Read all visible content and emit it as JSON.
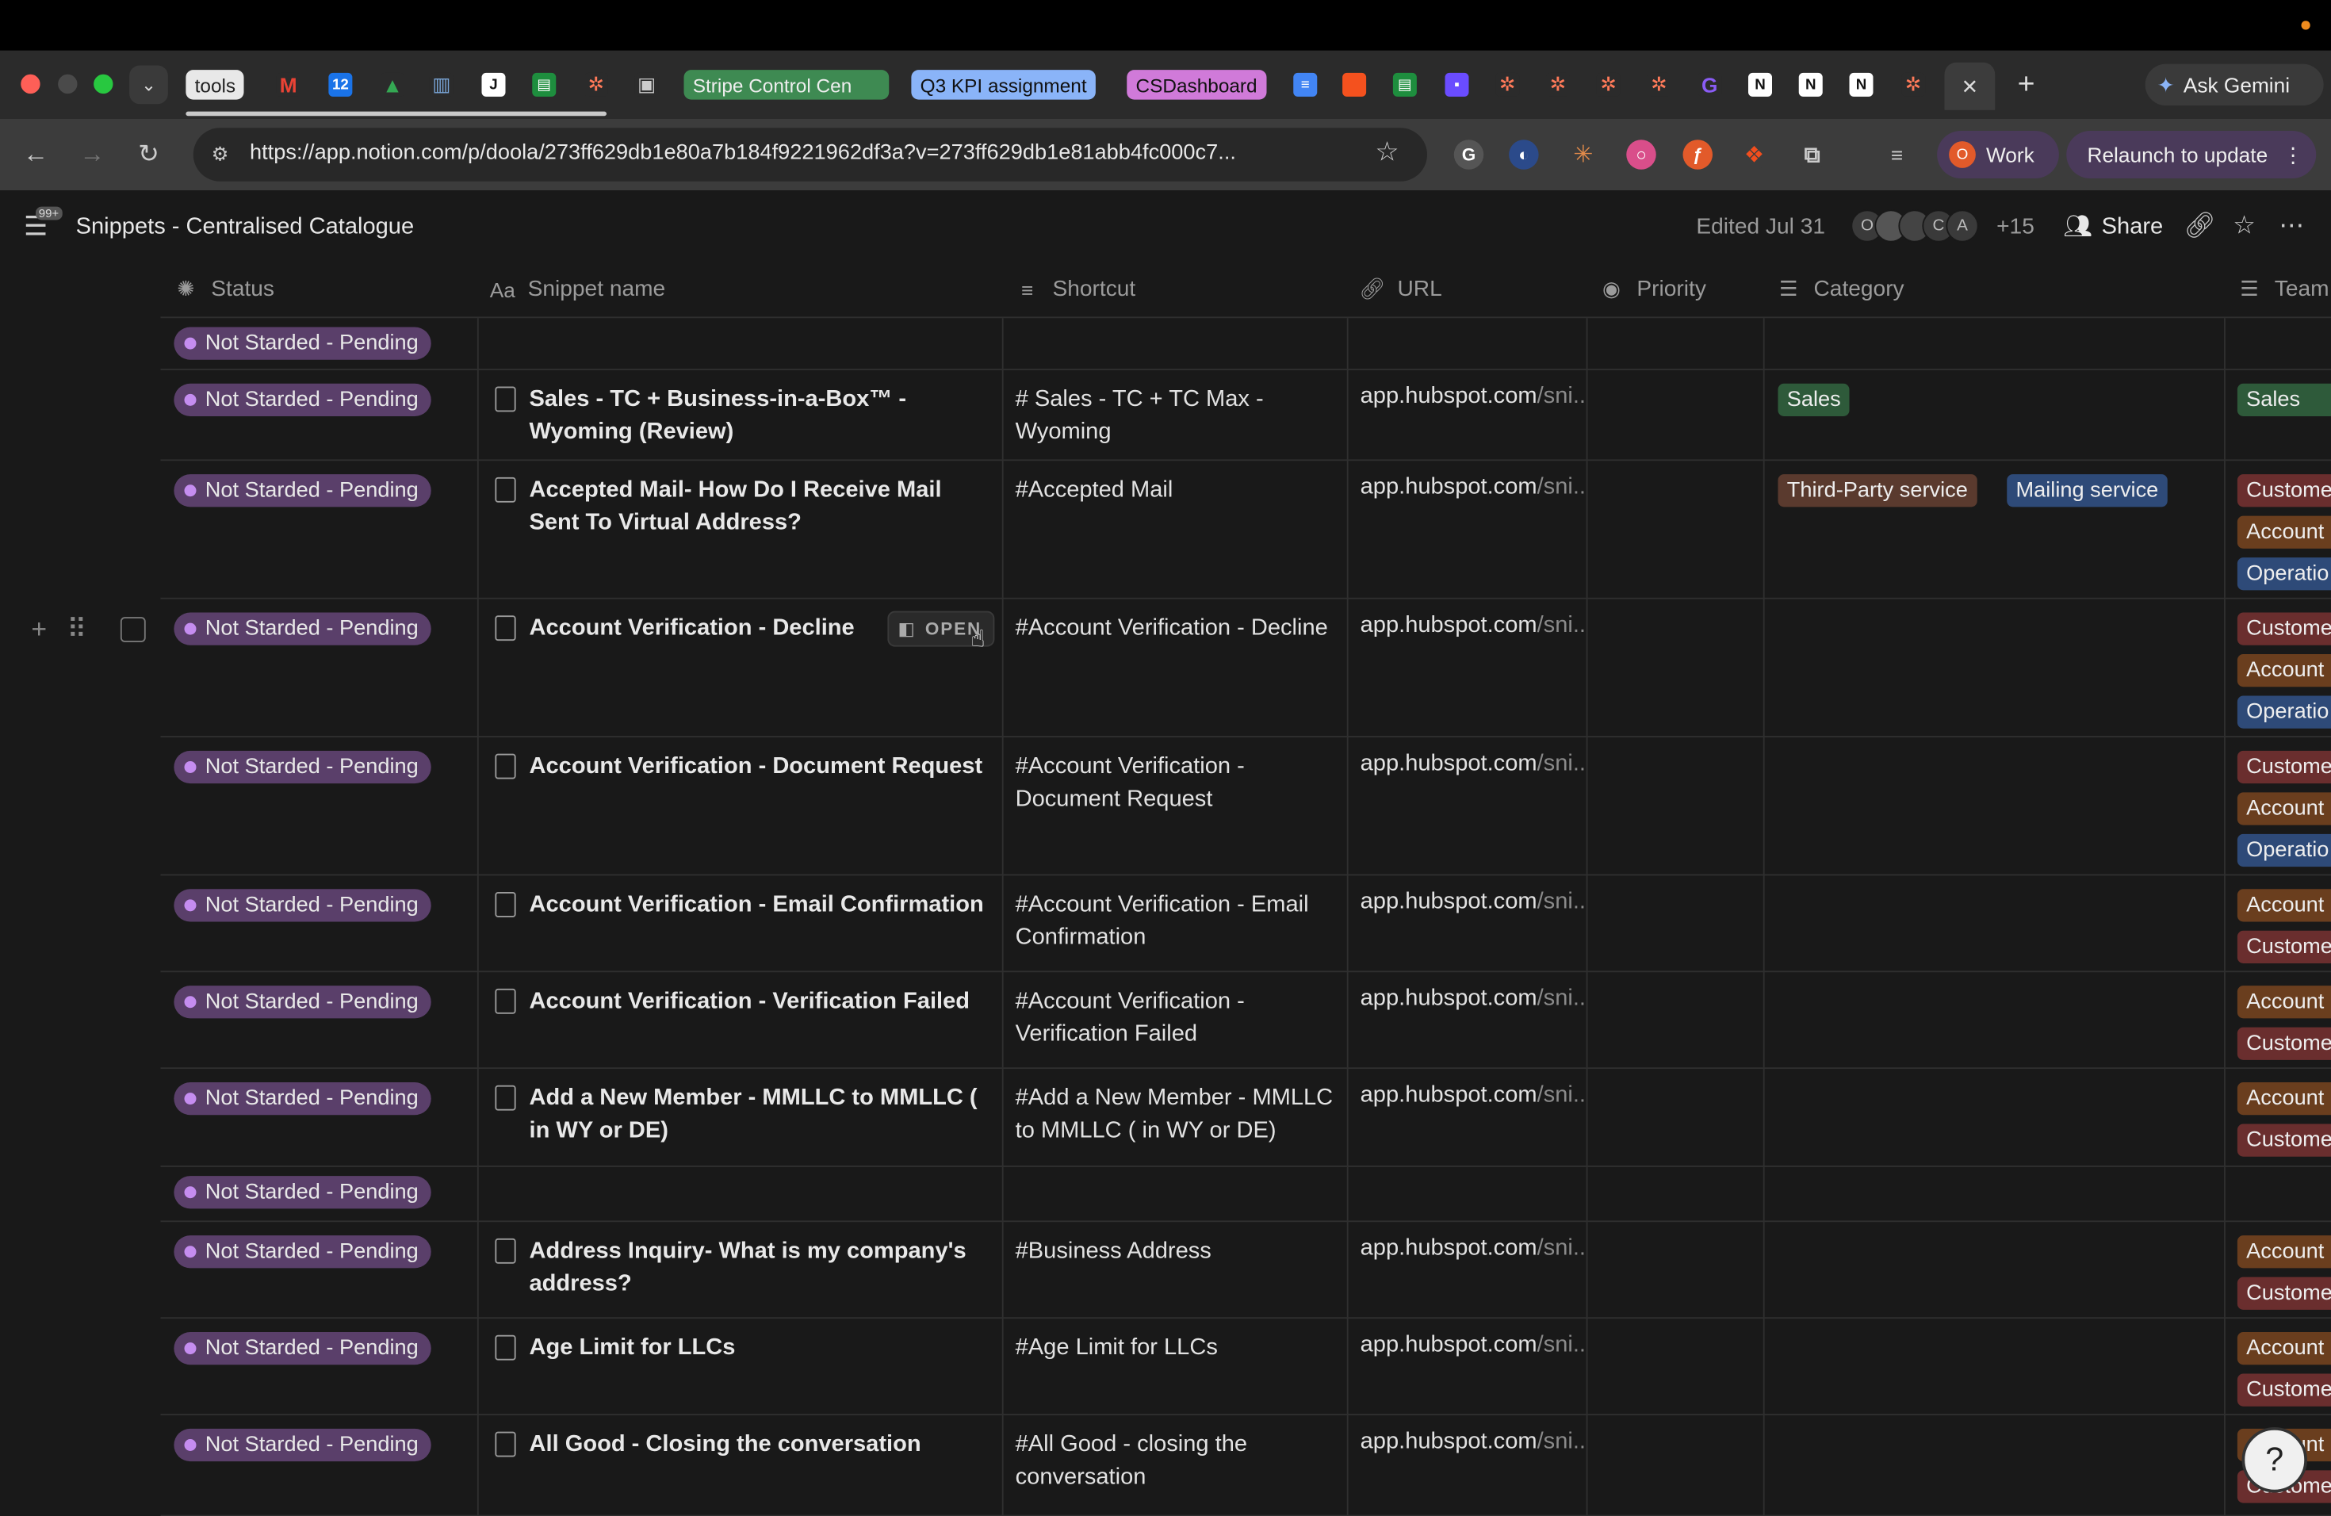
{
  "browser": {
    "tabs": {
      "tools": "tools",
      "stripe": "Stripe Control Cen",
      "q3": "Q3 KPI assignment",
      "cs": "CSDashboard",
      "calendar_day": "12"
    },
    "url": "https://app.notion.com/p/doola/273ff629db1e80a7b184f9221962df3a?v=273ff629db1e81abb4fc000c7...",
    "gemini": "Ask Gemini",
    "profile_name": "Work",
    "profile_initial": "O",
    "relaunch": "Relaunch to update",
    "new_tab": "+",
    "close_tab": "×"
  },
  "page": {
    "title": "Snippets - Centralised Catalogue",
    "notification_count": "99+",
    "edited": "Edited Jul 31",
    "collaborators": [
      "O",
      "",
      "",
      "C",
      "A"
    ],
    "collaborators_more": "+15",
    "share": "Share"
  },
  "columns": {
    "status": "Status",
    "name": "Snippet name",
    "shortcut": "Shortcut",
    "url": "URL",
    "priority": "Priority",
    "category": "Category",
    "team": "Team"
  },
  "open_label": "OPEN",
  "rows": [
    {
      "status": "Not Starded - Pending",
      "name": "",
      "shortcut": "",
      "url": "",
      "url_tail": ""
    },
    {
      "status": "Not Starded - Pending",
      "name": "Sales - TC + Business-in-a-Box™ - Wyoming (Review)",
      "shortcut": "# Sales - TC + TC Max - Wyoming",
      "url": "app.hubspot.com",
      "url_tail": "/sni..",
      "category": [
        "Sales"
      ],
      "team": [
        "Sales"
      ]
    },
    {
      "status": "Not Starded - Pending",
      "name": "Accepted Mail- How Do I Receive Mail Sent To Virtual Address?",
      "shortcut": "#Accepted Mail",
      "url": "app.hubspot.com",
      "url_tail": "/sni..",
      "category": [
        "Third-Party service",
        "Mailing service"
      ],
      "team": [
        "Custome",
        "Account",
        "Operatio"
      ]
    },
    {
      "status": "Not Starded - Pending",
      "name": "Account Verification - Decline",
      "shortcut": "#Account Verification - Decline",
      "url": "app.hubspot.com",
      "url_tail": "/sni..",
      "team": [
        "Custome",
        "Account",
        "Operatio"
      ]
    },
    {
      "status": "Not Starded - Pending",
      "name": "Account Verification - Document Request",
      "shortcut": "#Account Verification - Document Request",
      "url": "app.hubspot.com",
      "url_tail": "/sni..",
      "team": [
        "Custome",
        "Account",
        "Operatio"
      ]
    },
    {
      "status": "Not Starded - Pending",
      "name": "Account Verification - Email Confirmation",
      "shortcut": "#Account Verification - Email Confirmation",
      "url": "app.hubspot.com",
      "url_tail": "/sni..",
      "team": [
        "Account",
        "Custome"
      ]
    },
    {
      "status": "Not Starded - Pending",
      "name": "Account Verification - Verification Failed",
      "shortcut": "#Account Verification - Verification Failed",
      "url": "app.hubspot.com",
      "url_tail": "/sni..",
      "team": [
        "Account",
        "Custome"
      ]
    },
    {
      "status": "Not Starded - Pending",
      "name": "Add a New Member - MMLLC to MMLLC ( in WY or DE)",
      "shortcut": "#Add a New Member - MMLLC to MMLLC ( in WY or DE)",
      "url": "app.hubspot.com",
      "url_tail": "/sni..",
      "team": [
        "Account",
        "Custome"
      ]
    },
    {
      "status": "Not Starded - Pending",
      "name": "",
      "shortcut": "",
      "url": "",
      "url_tail": ""
    },
    {
      "status": "Not Starded - Pending",
      "name": "Address Inquiry- What is my company's address?",
      "shortcut": "#Business Address",
      "url": "app.hubspot.com",
      "url_tail": "/sni..",
      "team": [
        "Account",
        "Custome"
      ]
    },
    {
      "status": "Not Starded - Pending",
      "name": "Age Limit for LLCs",
      "shortcut": "#Age Limit for LLCs",
      "url": "app.hubspot.com",
      "url_tail": "/sni..",
      "team": [
        "Account",
        "Custome"
      ]
    },
    {
      "status": "Not Starded - Pending",
      "name": "All Good - Closing the conversation",
      "shortcut": "#All Good - closing the conversation",
      "url": "app.hubspot.com",
      "url_tail": "/sni..",
      "team": [
        "Account",
        "Custome"
      ]
    }
  ],
  "colors": {
    "status_bg": "#5a3f6a",
    "status_dot": "#c58df0",
    "tag_green": "#2e5a3a",
    "tag_blue": "#2e4a78",
    "tag_brown": "#5a3a2e",
    "tag_red": "#6a2e2e"
  }
}
